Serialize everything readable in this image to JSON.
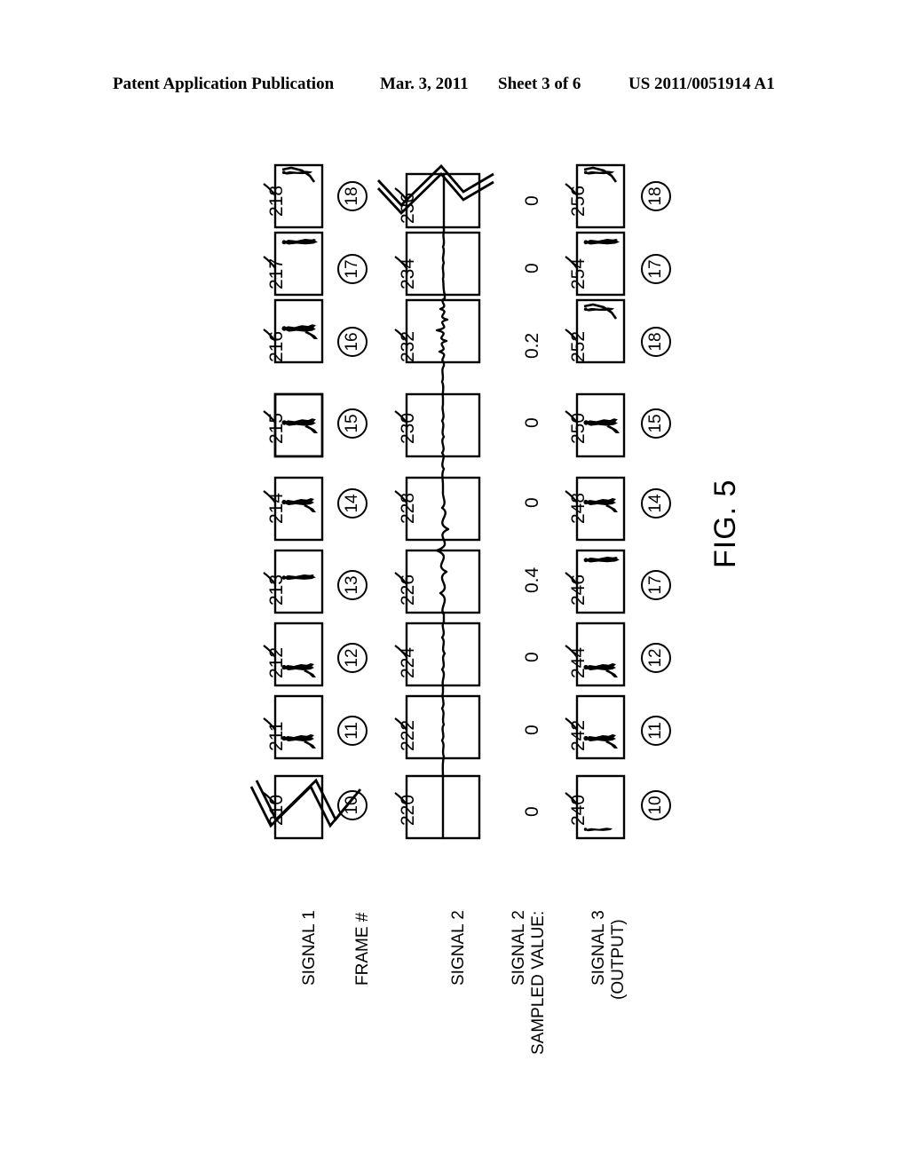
{
  "header": {
    "publication": "Patent Application Publication",
    "date": "Mar. 3, 2011",
    "sheet": "Sheet 3 of 6",
    "patent_number": "US 2011/0051914 A1"
  },
  "figure": {
    "label": "FIG. 5",
    "row_labels": {
      "signal1": "SIGNAL 1",
      "frame_number": "FRAME #",
      "signal2": "SIGNAL 2",
      "signal2_sampled_line1": "SIGNAL 2",
      "signal2_sampled_line2": "SAMPLED VALUE:",
      "signal3_line1": "SIGNAL 3",
      "signal3_line2": "(OUTPUT)"
    },
    "columns": [
      {
        "index": 0,
        "signal1_ref": "210",
        "frame_number": "10",
        "signal2_ref": "220",
        "sampled_value": "0",
        "signal3_ref": "240",
        "output_frame_number": "10"
      },
      {
        "index": 1,
        "signal1_ref": "211",
        "frame_number": "11",
        "signal2_ref": "222",
        "sampled_value": "0",
        "signal3_ref": "242",
        "output_frame_number": "11"
      },
      {
        "index": 2,
        "signal1_ref": "212",
        "frame_number": "12",
        "signal2_ref": "224",
        "sampled_value": "0",
        "signal3_ref": "244",
        "output_frame_number": "12"
      },
      {
        "index": 3,
        "signal1_ref": "213",
        "frame_number": "13",
        "signal2_ref": "226",
        "sampled_value": "0.4",
        "signal3_ref": "246",
        "output_frame_number": "17"
      },
      {
        "index": 4,
        "signal1_ref": "214",
        "frame_number": "14",
        "signal2_ref": "228",
        "sampled_value": "0",
        "signal3_ref": "248",
        "output_frame_number": "14"
      },
      {
        "index": 5,
        "signal1_ref": "215",
        "frame_number": "15",
        "signal2_ref": "230",
        "sampled_value": "0",
        "signal3_ref": "250",
        "output_frame_number": "15"
      },
      {
        "index": 6,
        "signal1_ref": "216",
        "frame_number": "16",
        "signal2_ref": "232",
        "sampled_value": "0.2",
        "signal3_ref": "252",
        "output_frame_number": "18"
      },
      {
        "index": 7,
        "signal1_ref": "217",
        "frame_number": "17",
        "signal2_ref": "234",
        "sampled_value": "0",
        "signal3_ref": "254",
        "output_frame_number": "17"
      },
      {
        "index": 8,
        "signal1_ref": "218",
        "frame_number": "18",
        "signal2_ref": "236",
        "sampled_value": "0",
        "signal3_ref": "256",
        "output_frame_number": "18"
      }
    ]
  }
}
